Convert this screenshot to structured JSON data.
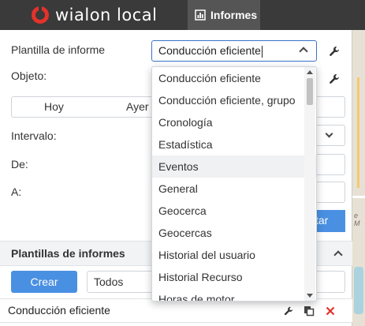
{
  "header": {
    "logo_text": "wialon local",
    "active_tab": "Informes"
  },
  "form": {
    "template_label": "Plantilla de informe",
    "template_value": "Conducción eficiente",
    "object_label": "Objeto:",
    "day_tabs": [
      "Hoy",
      "Ayer"
    ],
    "interval_label": "Intervalo:",
    "from_label": "De:",
    "to_label": "A:",
    "execute_partial": "tar"
  },
  "dropdown": {
    "items": [
      "Conducción eficiente",
      "Conducción eficiente, grupo",
      "Cronología",
      "Estadística",
      "Eventos",
      "General",
      "Geocerca",
      "Geocercas",
      "Historial del usuario",
      "Historial Recurso",
      "Horas de motor"
    ],
    "hovered_index": 4
  },
  "templates_section": {
    "title": "Plantillas de informes",
    "create_label": "Crear",
    "filter_value": "Todos",
    "rows": [
      "Conducción eficiente"
    ]
  },
  "map": {
    "partial_label": "e M"
  },
  "colors": {
    "topbar": "#3a3a3a",
    "accent": "#4a90e2",
    "delete": "#e4322b"
  }
}
